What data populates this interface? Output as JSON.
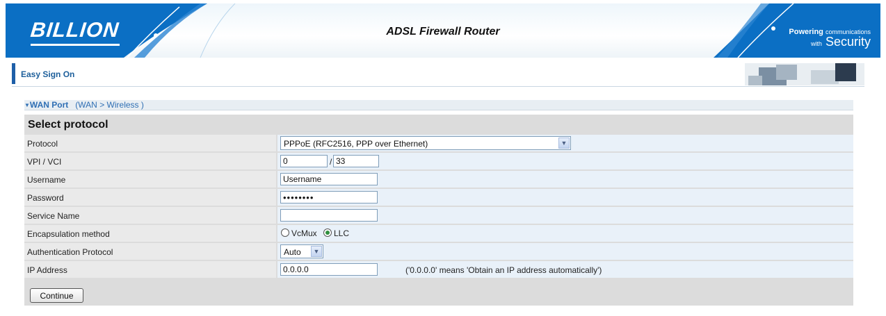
{
  "header": {
    "logo_text": "BILLION",
    "title": "ADSL Firewall Router",
    "tagline_powering": "Powering",
    "tagline_communications": "communications",
    "tagline_with": "with",
    "tagline_security": "Security"
  },
  "signon": {
    "title": "Easy Sign On"
  },
  "breadcrumb": {
    "current": "WAN Port",
    "open_paren": "(",
    "link_wan": "WAN",
    "separator": ">",
    "link_wireless": "Wireless",
    "close_paren": ")"
  },
  "form": {
    "section_title": "Select protocol",
    "protocol": {
      "label": "Protocol",
      "value": "PPPoE (RFC2516, PPP over Ethernet)"
    },
    "vpivci": {
      "label": "VPI / VCI",
      "vpi": "0",
      "slash": "/",
      "vci": "33"
    },
    "username": {
      "label": "Username",
      "value": "Username"
    },
    "password": {
      "label": "Password",
      "value": "••••••••"
    },
    "service_name": {
      "label": "Service Name",
      "value": ""
    },
    "encapsulation": {
      "label": "Encapsulation method",
      "options": [
        "VcMux",
        "LLC"
      ],
      "selected": "LLC"
    },
    "auth": {
      "label": "Authentication Protocol",
      "value": "Auto"
    },
    "ip": {
      "label": "IP Address",
      "value": "0.0.0.0",
      "hint": "('0.0.0.0' means 'Obtain an IP address automatically')"
    },
    "continue_label": "Continue"
  },
  "colors": {
    "banner_blue": "#0a6fc2",
    "accent": "#1e5fa8",
    "link": "#2f6fb4"
  }
}
